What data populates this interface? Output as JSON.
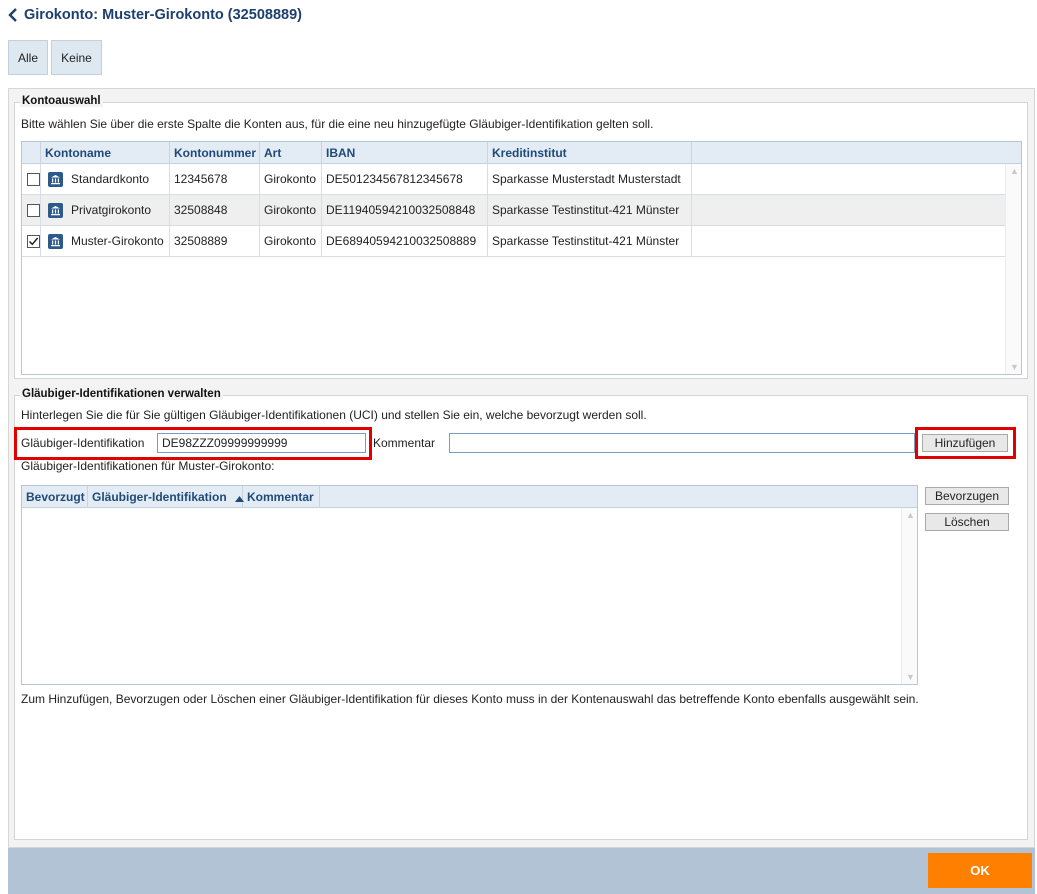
{
  "header": {
    "title": "Girokonto: Muster-Girokonto (32508889)"
  },
  "toolbar": {
    "all_label": "Alle",
    "none_label": "Keine"
  },
  "kontoauswahl": {
    "legend": "Kontoauswahl",
    "description": "Bitte wählen Sie über die erste Spalte die Konten aus, für die eine neu hinzugefügte Gläubiger-Identifikation gelten soll.",
    "columns": [
      "Kontoname",
      "Kontonummer",
      "Art",
      "IBAN",
      "Kreditinstitut"
    ],
    "rows": [
      {
        "checked": false,
        "name": "Standardkonto",
        "number": "12345678",
        "type": "Girokonto",
        "iban": "DE501234567812345678",
        "bank": "Sparkasse Musterstadt Musterstadt"
      },
      {
        "checked": false,
        "name": "Privatgirokonto",
        "number": "32508848",
        "type": "Girokonto",
        "iban": "DE11940594210032508848",
        "bank": "Sparkasse Testinstitut-421 Münster"
      },
      {
        "checked": true,
        "name": "Muster-Girokonto",
        "number": "32508889",
        "type": "Girokonto",
        "iban": "DE68940594210032508889",
        "bank": "Sparkasse Testinstitut-421 Münster"
      }
    ]
  },
  "glaeubiger": {
    "legend": "Gläubiger-Identifikationen verwalten",
    "description": "Hinterlegen Sie die für Sie gültigen Gläubiger-Identifikationen (UCI) und stellen Sie ein, welche bevorzugt werden soll.",
    "id_label": "Gläubiger-Identifikation",
    "id_value": "DE98ZZZ09999999999",
    "comment_label": "Kommentar",
    "comment_value": "",
    "add_label": "Hinzufügen",
    "list_title": "Gläubiger-Identifikationen für Muster-Girokonto:",
    "columns": [
      "Bevorzugt",
      "Gläubiger-Identifikation",
      "Kommentar"
    ],
    "prefer_label": "Bevorzugen",
    "delete_label": "Löschen",
    "footnote": "Zum Hinzufügen, Bevorzugen oder Löschen einer Gläubiger-Identifikation für dieses Konto muss in der Kontenauswahl das betreffende Konto ebenfalls ausgewählt sein."
  },
  "footer": {
    "ok_label": "OK"
  },
  "colors": {
    "accent": "#ff7f00",
    "highlight": "#e00000",
    "header_text": "#1c3f6e"
  }
}
